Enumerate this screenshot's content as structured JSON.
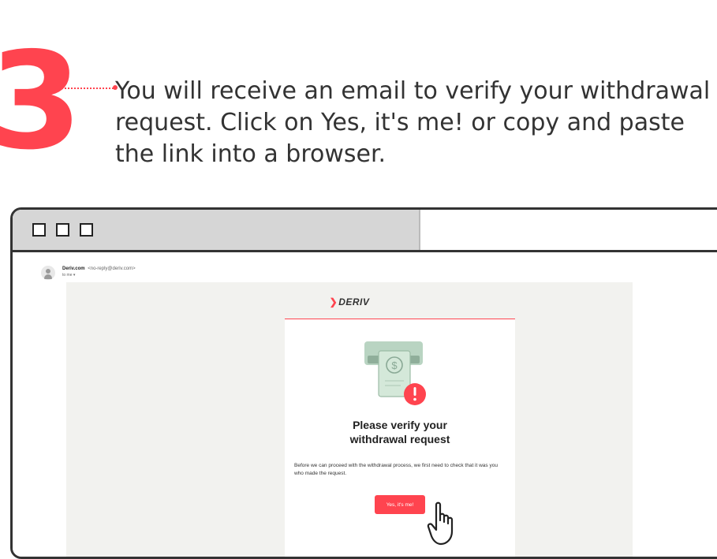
{
  "step": {
    "number": "3",
    "instruction": "You will receive an email to verify your withdrawal request. Click on Yes, it's me! or copy and paste the link into a browser."
  },
  "email": {
    "sender_name": "Deriv.com",
    "sender_email": "<no-reply@deriv.com>",
    "recipient": "to me ▾",
    "brand": "DERIV",
    "title_line1": "Please verify your",
    "title_line2": "withdrawal request",
    "body": "Before we can proceed with the withdrawal process, we first need to check that it was you who made the request.",
    "button_label": "Yes, it's me!"
  },
  "colors": {
    "accent": "#ff444f",
    "text": "#333333",
    "email_background": "#f2f2ef"
  }
}
